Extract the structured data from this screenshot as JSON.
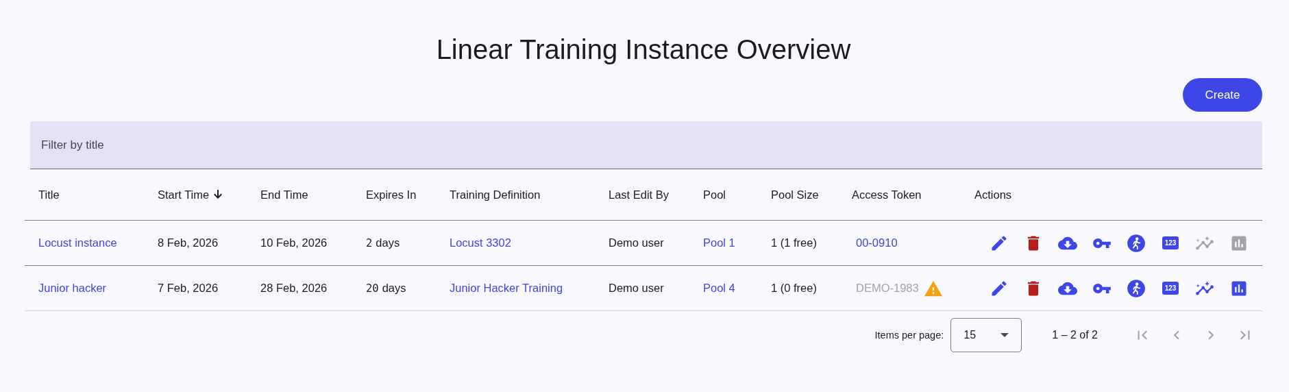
{
  "page": {
    "title": "Linear Training Instance Overview"
  },
  "create_button": {
    "label": "Create"
  },
  "filter": {
    "placeholder": "Filter by title"
  },
  "table": {
    "columns": [
      {
        "label": "Title",
        "sorted": false
      },
      {
        "label": "Start Time",
        "sorted": true
      },
      {
        "label": "End Time",
        "sorted": false
      },
      {
        "label": "Expires In",
        "sorted": false
      },
      {
        "label": "Training Definition",
        "sorted": false
      },
      {
        "label": "Last Edit By",
        "sorted": false
      },
      {
        "label": "Pool",
        "sorted": false
      },
      {
        "label": "Pool Size",
        "sorted": false
      },
      {
        "label": "Access Token",
        "sorted": false
      },
      {
        "label": "Actions",
        "sorted": false
      }
    ],
    "rows": [
      {
        "title": "Locust instance",
        "start_time": "8 Feb, 2026",
        "end_time": "10 Feb, 2026",
        "expires_number": "2",
        "expires_unit": "days",
        "training_definition": "Locust 3302",
        "last_edit_by": "Demo user",
        "pool": "Pool 1",
        "pool_size": "1 (1 free)",
        "access_token": {
          "text": "00-0910",
          "disabled": false,
          "warning": false
        },
        "actions": [
          {
            "kind": "edit",
            "disabled": false
          },
          {
            "kind": "delete",
            "disabled": false
          },
          {
            "kind": "download",
            "disabled": false
          },
          {
            "kind": "key",
            "disabled": false
          },
          {
            "kind": "run",
            "disabled": false
          },
          {
            "kind": "numbers",
            "label": "123",
            "disabled": false
          },
          {
            "kind": "insights",
            "disabled": true
          },
          {
            "kind": "chart",
            "disabled": true
          }
        ]
      },
      {
        "title": "Junior hacker",
        "start_time": "7 Feb, 2026",
        "end_time": "28 Feb, 2026",
        "expires_number": "20",
        "expires_unit": "days",
        "training_definition": "Junior Hacker Training",
        "last_edit_by": "Demo user",
        "pool": "Pool 4",
        "pool_size": "1 (0 free)",
        "access_token": {
          "text": "DEMO-1983",
          "disabled": true,
          "warning": true
        },
        "actions": [
          {
            "kind": "edit",
            "disabled": false
          },
          {
            "kind": "delete",
            "disabled": false
          },
          {
            "kind": "download",
            "disabled": false
          },
          {
            "kind": "key",
            "disabled": false
          },
          {
            "kind": "run",
            "disabled": false
          },
          {
            "kind": "numbers",
            "label": "123",
            "disabled": false
          },
          {
            "kind": "insights",
            "disabled": false
          },
          {
            "kind": "chart",
            "disabled": false
          }
        ]
      }
    ]
  },
  "paginator": {
    "label": "Items per page:",
    "page_size": "15",
    "range": "1 – 2 of 2",
    "buttons": [
      {
        "kind": "first",
        "disabled": true
      },
      {
        "kind": "previous",
        "disabled": true
      },
      {
        "kind": "next",
        "disabled": true
      },
      {
        "kind": "last",
        "disabled": true
      }
    ]
  }
}
